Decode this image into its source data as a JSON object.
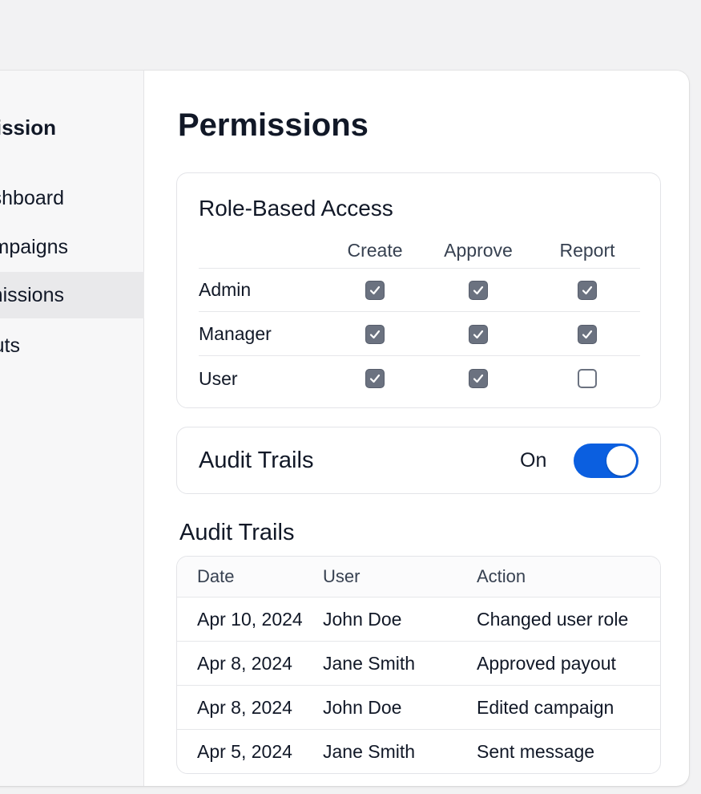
{
  "sidebar": {
    "title": "Permission",
    "items": [
      {
        "label": "Dashboard"
      },
      {
        "label": "Campaigns"
      },
      {
        "label": "Permissions"
      },
      {
        "label": "Payouts"
      }
    ]
  },
  "page": {
    "title": "Permissions"
  },
  "role_based_access": {
    "title": "Role-Based Access",
    "columns": [
      "Create",
      "Approve",
      "Report"
    ],
    "rows": [
      {
        "role": "Admin",
        "checked": [
          true,
          true,
          true
        ]
      },
      {
        "role": "Manager",
        "checked": [
          true,
          true,
          true
        ]
      },
      {
        "role": "User",
        "checked": [
          true,
          true,
          false
        ]
      }
    ]
  },
  "audit_toggle": {
    "title": "Audit Trails",
    "state_label": "On",
    "enabled": true,
    "accent_color": "#0b5fe0"
  },
  "audit_log": {
    "title": "Audit Trails",
    "columns": [
      "Date",
      "User",
      "Action"
    ],
    "rows": [
      {
        "date": "Apr 10, 2024",
        "user": "John Doe",
        "action": "Changed user role"
      },
      {
        "date": "Apr 8, 2024",
        "user": "Jane Smith",
        "action": "Approved payout"
      },
      {
        "date": "Apr 8, 2024",
        "user": "John Doe",
        "action": "Edited campaign"
      },
      {
        "date": "Apr 5, 2024",
        "user": "Jane Smith",
        "action": "Sent message"
      }
    ]
  },
  "icons": {
    "checkbox_checked": "checkmark-icon",
    "checkbox_unchecked": "empty-box"
  }
}
